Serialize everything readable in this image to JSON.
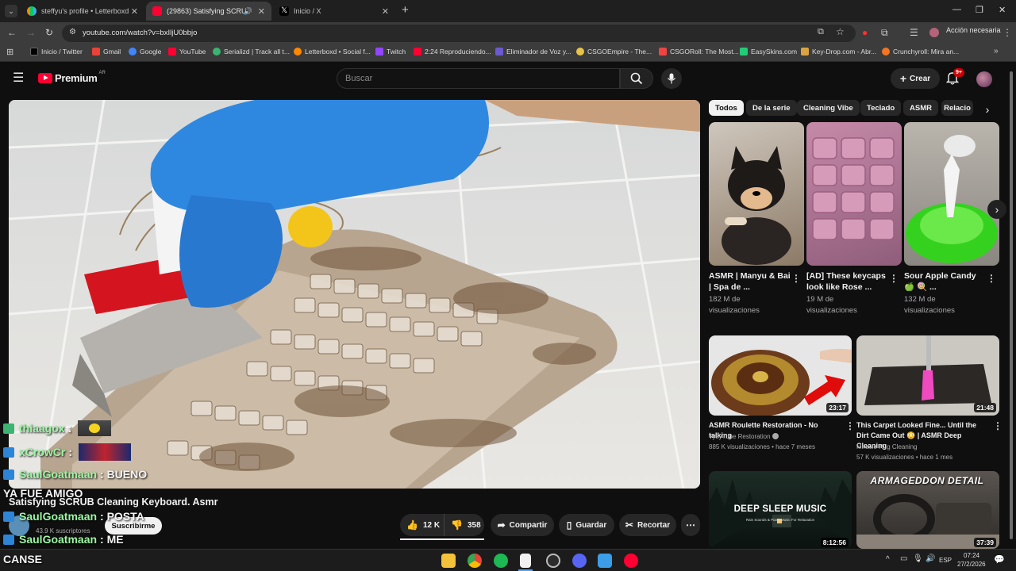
{
  "browser": {
    "tabs": [
      {
        "title": "steffyu's profile • Letterboxd"
      },
      {
        "title": "(29863) Satisfying SCRUB C"
      },
      {
        "title": "Inicio / X"
      }
    ],
    "url": "youtube.com/watch?v=bxIljU0bbjo",
    "action_label": "Acción necesaria",
    "bookmarks": [
      "Inicio / Twitter",
      "Gmail",
      "Google",
      "YouTube",
      "Serializd | Track all t...",
      "Letterboxd • Social f...",
      "Twitch",
      "2:24 Reproduciendo...",
      "Eliminador de Voz y...",
      "CSGOEmpire - The...",
      "CSGORoll: The Most...",
      "EasySkins.com",
      "Key-Drop.com - Abr...",
      "Crunchyroll: Mira an..."
    ]
  },
  "yt": {
    "logo_text": "Premium",
    "country": "AR",
    "search_placeholder": "Buscar",
    "create_label": "Crear",
    "notif_count": "9+"
  },
  "chat": [
    {
      "user": "thiaagox",
      "msg": ":"
    },
    {
      "user": "xCrowCr",
      "msg": ":"
    },
    {
      "user": "SaulGoatmaan",
      "msg": ": BUENO"
    },
    {
      "user": "",
      "msg": "YA FUE AMIGO"
    },
    {
      "user": "SaulGoatmaan",
      "msg": ": POSTA"
    },
    {
      "user": "SaulGoatmaan",
      "msg": ": ME"
    },
    {
      "user": "",
      "msg": "CANSE"
    }
  ],
  "video": {
    "title": "Satisfying SCRUB Cleaning Keyboard. Asmr",
    "subscribers": "43.9 K suscriptores",
    "subscribe_label": "Suscribirme",
    "likes": "12 K",
    "dislikes": "358",
    "share_label": "Compartir",
    "save_label": "Guardar",
    "clip_label": "Recortar"
  },
  "chips": [
    "Todos",
    "De la serie",
    "Cleaning Vibe",
    "Teclado",
    "ASMR",
    "Relacio"
  ],
  "shorts": [
    {
      "title": "ASMR | Manyu & Bai | Spa de ...",
      "views": "182 M de visualizaciones"
    },
    {
      "title": "[AD] These keycaps look like Rose ...",
      "views": "19 M de visualizaciones"
    },
    {
      "title": "Sour Apple Candy 🍏 🍭 ...",
      "views": "132 M de visualizaciones"
    }
  ],
  "videos": [
    {
      "title": "ASMR Roulette Restoration - No talking",
      "channel": "TysyTube Restoration",
      "meta": "885 K visualizaciones • hace 7 meses",
      "duration": "23:17"
    },
    {
      "title": "This Carpet Looked Fine... Until the Dirt Came Out 😳 | ASMR Deep Cleaning",
      "channel": "Miracle Rug Cleaning",
      "meta": "57 K visualizaciones • hace 1 mes",
      "duration": "21:48"
    },
    {
      "title": "DEEP SLEEP MUSIC",
      "subtitle": "Rain Sounds & Piano Music For Relaxation",
      "duration": "8:12:56"
    },
    {
      "title": "ARMAGEDDON DETAIL",
      "duration": "37:39"
    }
  ],
  "taskbar": {
    "lang": "ESP",
    "time": "07:24",
    "date": "27/2/2026"
  },
  "colors": {
    "yt_red": "#ff0033",
    "chat_name": "#9cf7a3",
    "bg": "#0f0f0f"
  }
}
